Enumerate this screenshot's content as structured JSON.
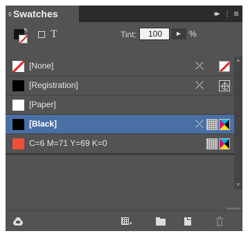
{
  "panel": {
    "title": "Swatches",
    "tab_arrows": "◊",
    "expand_glyph": "▸▸",
    "separator": "|",
    "menu_glyph": "≡"
  },
  "toolbar": {
    "text_toggle": "T",
    "tint_label": "Tint:",
    "tint_value": "100",
    "tint_button": "▶",
    "percent": "%"
  },
  "swatches": [
    {
      "name": "[None]",
      "chip": "none",
      "no_edit": true,
      "color_type": "none",
      "selected": false
    },
    {
      "name": "[Registration]",
      "chip": "black",
      "no_edit": true,
      "color_type": "registration",
      "selected": false
    },
    {
      "name": "[Paper]",
      "chip": "white",
      "no_edit": false,
      "color_type": "",
      "selected": false
    },
    {
      "name": "[Black]",
      "chip": "black",
      "no_edit": true,
      "color_type": "process-cmyk",
      "selected": true
    },
    {
      "name": "C=6 M=71 Y=69 K=0",
      "chip": "red",
      "no_edit": false,
      "color_type": "process-cmyk",
      "selected": false
    }
  ],
  "glyphs": {
    "no_edit": "⤫",
    "scroll_up": "▲",
    "scroll_down": "▼",
    "dropdown": "▾"
  },
  "colors": {
    "panel_bg": "#535353",
    "selected_row": "#4a6fa5",
    "swatch_red": "#ee4e3b",
    "none_slash": "#e02424"
  }
}
